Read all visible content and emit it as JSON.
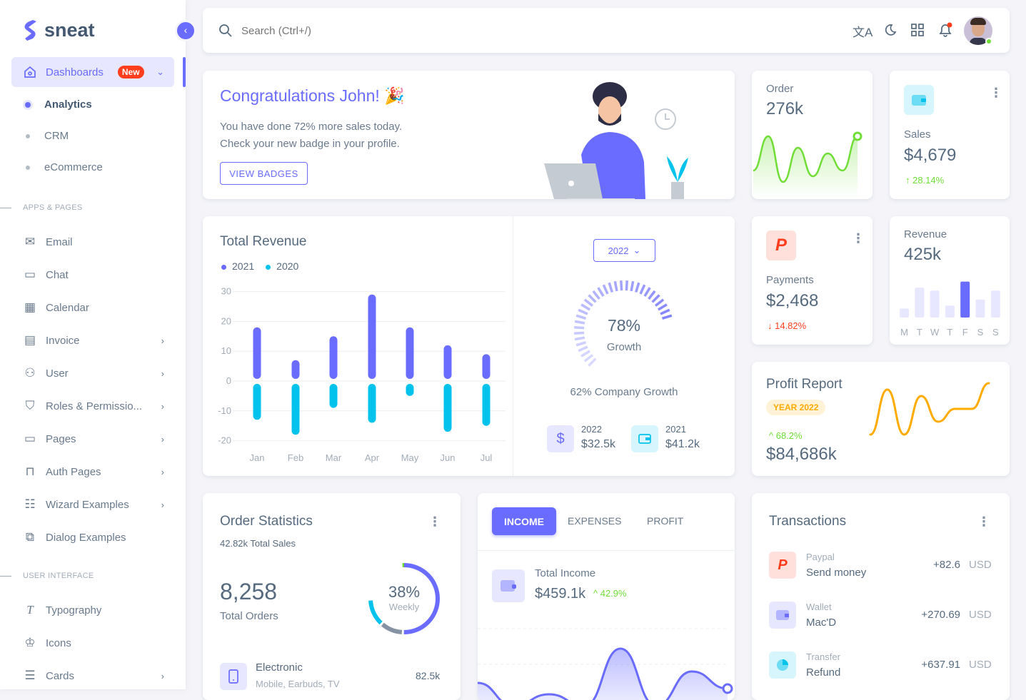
{
  "brand": {
    "name": "sneat",
    "accent": "#696cff"
  },
  "sidebar": {
    "dashboards": {
      "label": "Dashboards",
      "badge": "New"
    },
    "sub_items": [
      {
        "label": "Analytics",
        "active": true
      },
      {
        "label": "CRM"
      },
      {
        "label": "eCommerce"
      }
    ],
    "sections": [
      {
        "label": "APPS & PAGES"
      },
      {
        "label": "USER INTERFACE"
      }
    ],
    "items": [
      {
        "label": "Email",
        "icon": "mail-icon"
      },
      {
        "label": "Chat",
        "icon": "chat-icon"
      },
      {
        "label": "Calendar",
        "icon": "calendar-icon"
      },
      {
        "label": "Invoice",
        "icon": "invoice-icon",
        "chevron": true
      },
      {
        "label": "User",
        "icon": "user-icon",
        "chevron": true
      },
      {
        "label": "Roles & Permissio...",
        "icon": "shield-icon",
        "chevron": true
      },
      {
        "label": "Pages",
        "icon": "pages-icon",
        "chevron": true
      },
      {
        "label": "Auth Pages",
        "icon": "lock-icon",
        "chevron": true
      },
      {
        "label": "Wizard Examples",
        "icon": "wizard-icon",
        "chevron": true
      },
      {
        "label": "Dialog Examples",
        "icon": "dialog-icon"
      },
      {
        "label": "Typography",
        "icon": "typography-icon"
      },
      {
        "label": "Icons",
        "icon": "icons-icon"
      },
      {
        "label": "Cards",
        "icon": "cards-icon",
        "chevron": true
      }
    ]
  },
  "navbar": {
    "search_placeholder": "Search (Ctrl+/)",
    "icons": [
      "translate-icon",
      "moon-icon",
      "grid-icon",
      "bell-icon"
    ]
  },
  "congrats": {
    "title": "Congratulations John! 🎉",
    "line1": "You have done 72% more sales today.",
    "line2": "Check your new badge in your profile.",
    "button": "VIEW BADGES"
  },
  "order": {
    "label": "Order",
    "value": "276k"
  },
  "sales": {
    "label": "Sales",
    "value": "$4,679",
    "change": "↑ 28.14%"
  },
  "payments": {
    "label": "Payments",
    "value": "$2,468",
    "change": "↓ 14.82%"
  },
  "revenue": {
    "label": "Revenue",
    "value": "425k",
    "days": [
      "M",
      "T",
      "W",
      "T",
      "F",
      "S",
      "S"
    ]
  },
  "profit": {
    "title": "Profit Report",
    "badge": "YEAR 2022",
    "change": "^ 68.2%",
    "value": "$84,686k"
  },
  "growth": {
    "year_select": "2022",
    "percent": "78%",
    "label": "Growth",
    "company": "62% Company Growth",
    "stats": [
      {
        "year": "2022",
        "value": "$32.5k",
        "icon": "dollar-icon"
      },
      {
        "year": "2021",
        "value": "$41.2k",
        "icon": "wallet-icon"
      }
    ]
  },
  "order_stats": {
    "title": "Order Statistics",
    "subtitle": "42.82k Total Sales",
    "total": "8,258",
    "total_label": "Total Orders",
    "donut_value": "38%",
    "donut_label": "Weekly",
    "items": [
      {
        "name": "Electronic",
        "desc": "Mobile, Earbuds, TV",
        "value": "82.5k"
      }
    ]
  },
  "income": {
    "tabs": [
      "INCOME",
      "EXPENSES",
      "PROFIT"
    ],
    "active_tab": "INCOME",
    "label": "Total Income",
    "value": "$459.1k",
    "change": "^ 42.9%"
  },
  "transactions": {
    "title": "Transactions",
    "items": [
      {
        "type": "Paypal",
        "desc": "Send money",
        "amount": "+82.6",
        "currency": "USD",
        "icon": "paypal-icon",
        "color": "#ffe0db"
      },
      {
        "type": "Wallet",
        "desc": "Mac'D",
        "amount": "+270.69",
        "currency": "USD",
        "icon": "wallet-icon",
        "color": "#e7e7ff"
      },
      {
        "type": "Transfer",
        "desc": "Refund",
        "amount": "+637.91",
        "currency": "USD",
        "icon": "chart-icon",
        "color": "#d7f5fc"
      }
    ]
  },
  "chart_data": [
    {
      "type": "bar",
      "title": "Total Revenue",
      "categories": [
        "Jan",
        "Feb",
        "Mar",
        "Apr",
        "May",
        "Jun",
        "Jul"
      ],
      "series": [
        {
          "name": "2021",
          "values": [
            18,
            7,
            15,
            29,
            18,
            12,
            9
          ],
          "color": "#696cff"
        },
        {
          "name": "2020",
          "values": [
            -13,
            -18,
            -9,
            -14,
            -5,
            -17,
            -15
          ],
          "color": "#03c3ec"
        }
      ],
      "yticks": [
        30,
        20,
        10,
        0,
        -10,
        -20
      ],
      "ylim": [
        -20,
        30
      ],
      "grid": true,
      "legend": "top-left"
    },
    {
      "type": "bar",
      "title": "Revenue",
      "categories": [
        "M",
        "T",
        "W",
        "T",
        "F",
        "S",
        "S"
      ],
      "values": [
        3,
        10,
        9,
        4,
        12,
        6,
        9
      ]
    },
    {
      "type": "line",
      "title": "Order",
      "values": [
        2,
        5,
        1,
        4,
        1.5,
        3.5,
        2,
        5
      ]
    },
    {
      "type": "line",
      "title": "Profit Report",
      "values": [
        1,
        4.5,
        1,
        4,
        2,
        3,
        3,
        5
      ]
    },
    {
      "type": "area",
      "title": "Total Income",
      "values": [
        2,
        0,
        1,
        0,
        5,
        0,
        3,
        1.5
      ]
    },
    {
      "type": "donut",
      "title": "Order Statistics",
      "values": [
        85,
        15,
        50,
        50
      ],
      "colors": [
        "#696cff",
        "#8592a3",
        "#03c3ec",
        "#71dd37"
      ]
    }
  ]
}
